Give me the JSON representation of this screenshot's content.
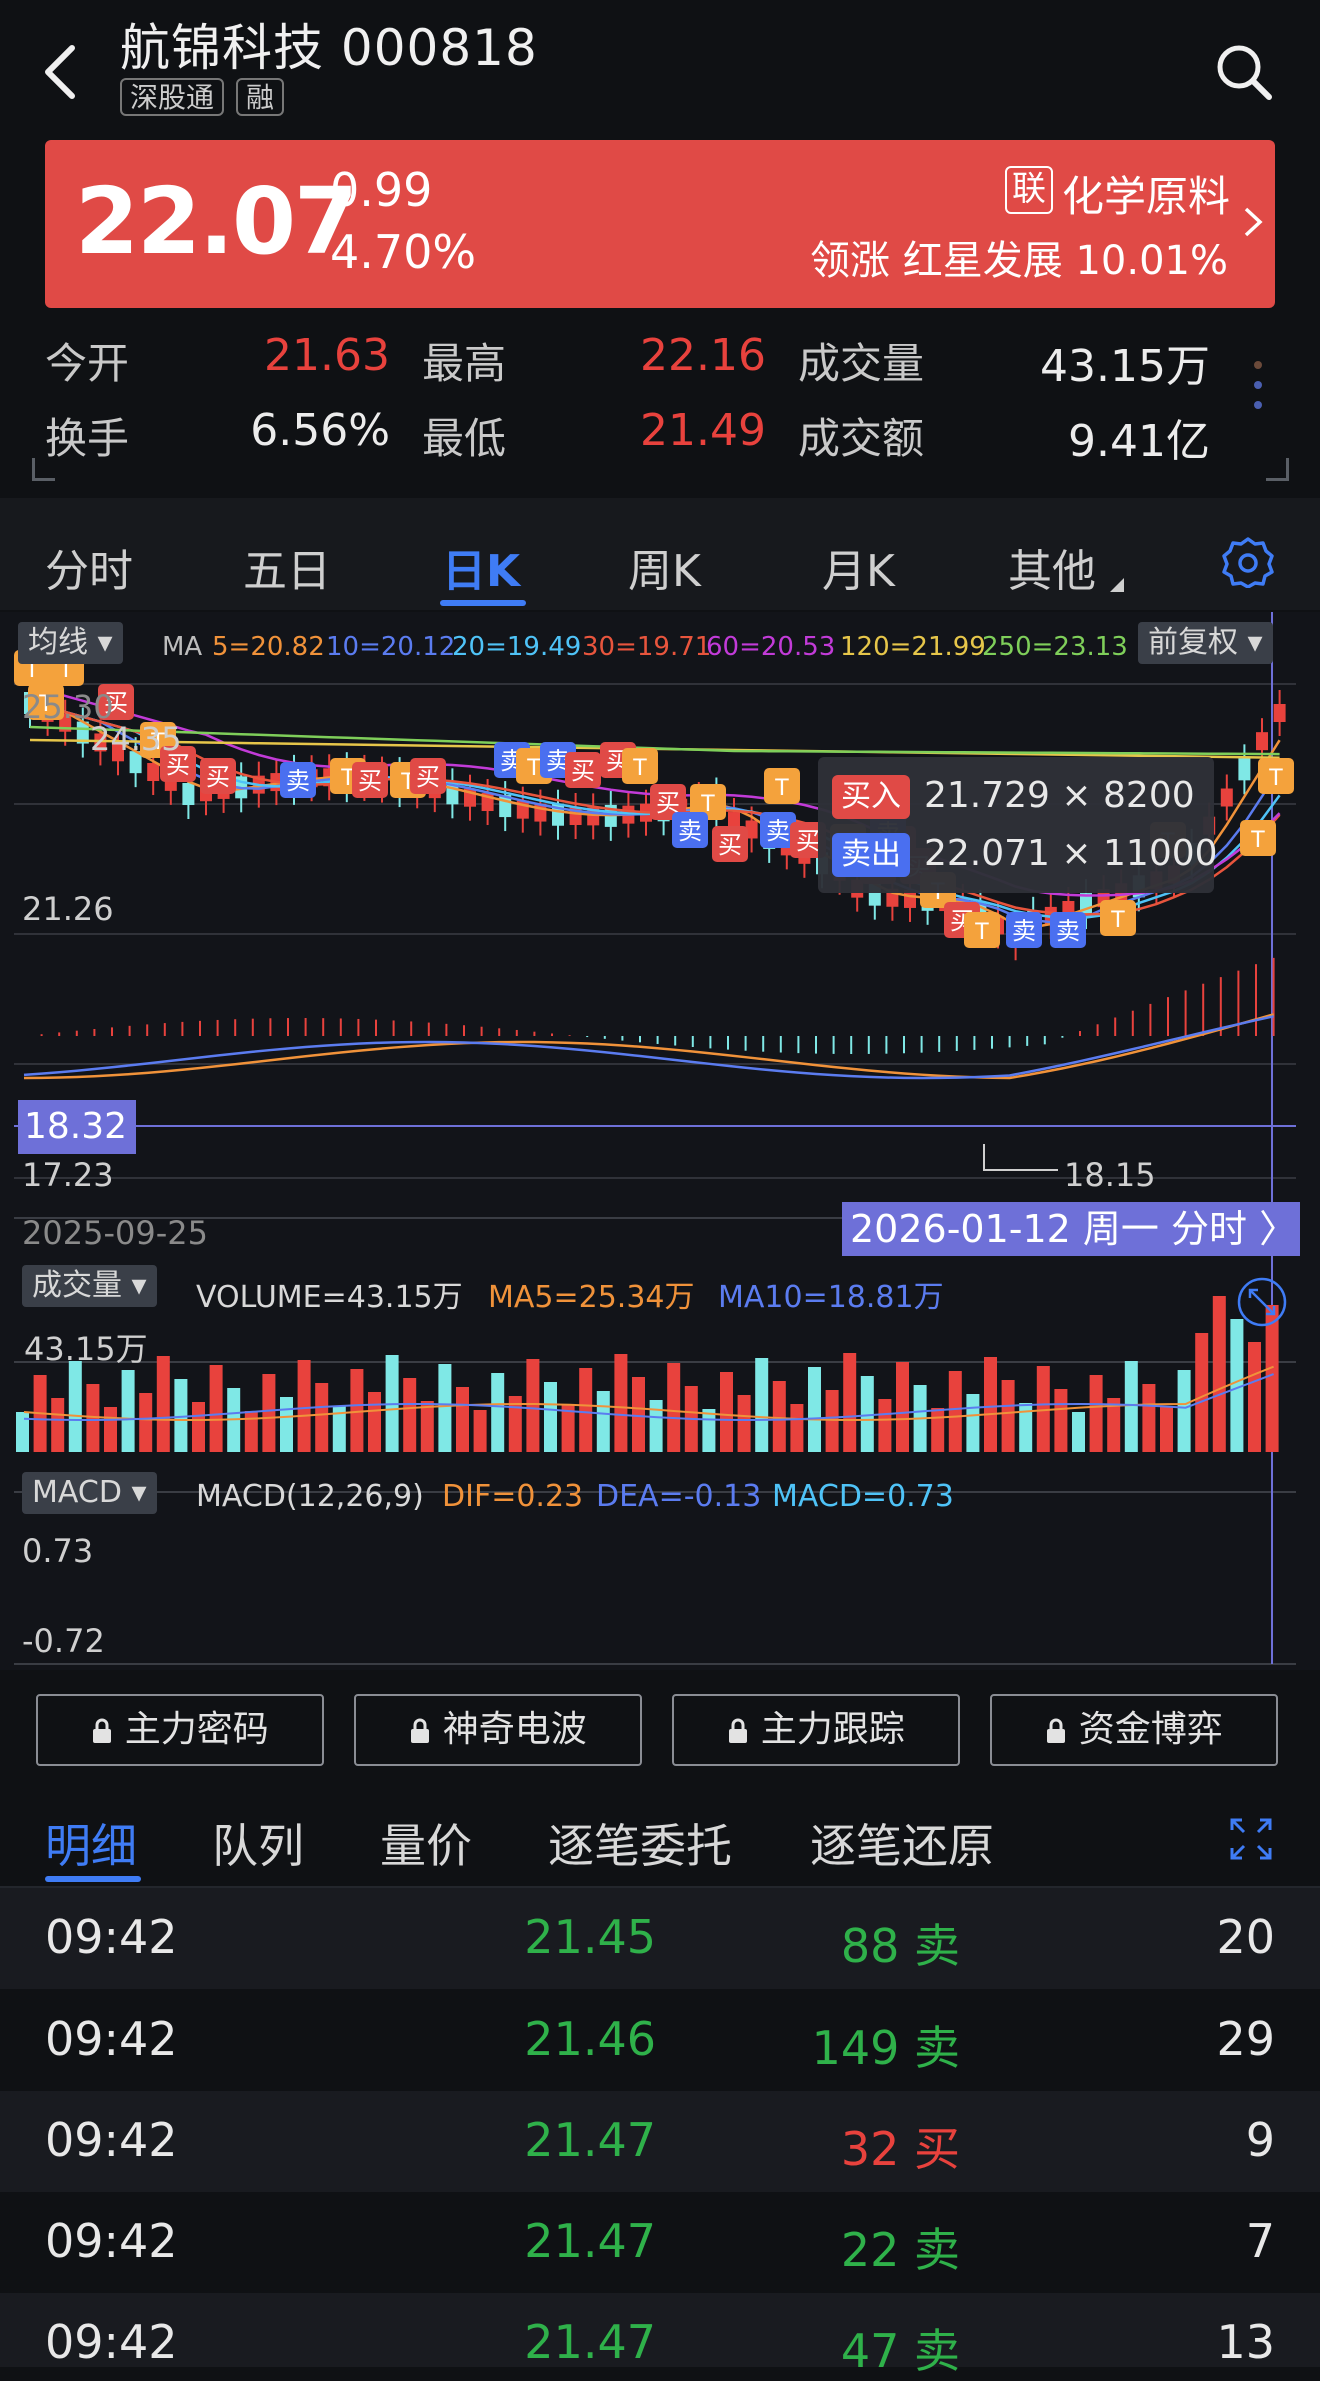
{
  "header": {
    "title": "航锦科技 000818",
    "tags": [
      "深股通",
      "融"
    ]
  },
  "quote": {
    "price": "22.07",
    "change": "0.99",
    "change_pct": "4.70%",
    "industry_badge": "联",
    "industry": "化学原料",
    "leader_text": "领涨 红星发展 10.01%"
  },
  "stats": [
    {
      "label": "今开",
      "value": "21.63"
    },
    {
      "label": "最高",
      "value": "22.16"
    },
    {
      "label": "成交量",
      "value": "43.15万"
    },
    {
      "label": "换手",
      "value": "6.56%"
    },
    {
      "label": "最低",
      "value": "21.49"
    },
    {
      "label": "成交额",
      "value": "9.41亿"
    }
  ],
  "tabs": [
    "分时",
    "五日",
    "日K",
    "周K",
    "月K",
    "其他"
  ],
  "active_tab": "日K",
  "kline": {
    "ma_button": "均线",
    "adjust_button": "前复权",
    "ma_prefix": "MA",
    "ma_values": [
      {
        "text": "5=20.82",
        "color": "#f0923a"
      },
      {
        "text": "10=20.12",
        "color": "#5b7cf0"
      },
      {
        "text": "20=19.49",
        "color": "#4fc3f7"
      },
      {
        "text": "30=19.71",
        "color": "#e8553d"
      },
      {
        "text": "60=20.53",
        "color": "#c23bd8"
      },
      {
        "text": "120=21.99",
        "color": "#e6c64a"
      },
      {
        "text": "250=23.13",
        "color": "#7fcf5a"
      }
    ],
    "high_label": "24.35",
    "top_axis": "25.30",
    "mid_axis": "21.26",
    "low_axis": "17.23",
    "cursor_price": "18.32",
    "min_label": "18.15",
    "start_date": "2025-09-25",
    "cursor_date": "2026-01-12 周一 分时 〉",
    "trade_buy_label": "买入",
    "trade_buy": "21.729 × 8200",
    "trade_sell_label": "卖出",
    "trade_sell": "22.071 × 11000",
    "markers": {
      "t": "T",
      "buy": "买",
      "sell": "卖"
    }
  },
  "volume": {
    "button": "成交量",
    "volume_text": "VOLUME=43.15万",
    "ma5_text": "MA5=25.34万",
    "ma10_text": "MA10=18.81万",
    "axis_label": "43.15万"
  },
  "macd": {
    "button": "MACD",
    "params": "MACD(12,26,9)",
    "dif": "DIF=0.23",
    "dea": "DEA=-0.13",
    "macd": "MACD=0.73",
    "axis_top": "0.73",
    "axis_bottom": "-0.72"
  },
  "lock_buttons": [
    "主力密码",
    "神奇电波",
    "主力跟踪",
    "资金博弈"
  ],
  "detail_tabs": [
    "明细",
    "队列",
    "量价",
    "逐笔委托",
    "逐笔还原"
  ],
  "trades": [
    {
      "time": "09:42",
      "price": "21.45",
      "vol": "88",
      "side": "卖",
      "count": "20"
    },
    {
      "time": "09:42",
      "price": "21.46",
      "vol": "149",
      "side": "卖",
      "count": "29"
    },
    {
      "time": "09:42",
      "price": "21.47",
      "vol": "32",
      "side": "买",
      "count": "9"
    },
    {
      "time": "09:42",
      "price": "21.47",
      "vol": "22",
      "side": "卖",
      "count": "7"
    },
    {
      "time": "09:42",
      "price": "21.47",
      "vol": "47",
      "side": "卖",
      "count": "13"
    }
  ],
  "colors": {
    "up": "#e8423d",
    "down": "#7fe8e6",
    "accent": "#3f7cf5",
    "trade_green": "#2fb14a"
  }
}
